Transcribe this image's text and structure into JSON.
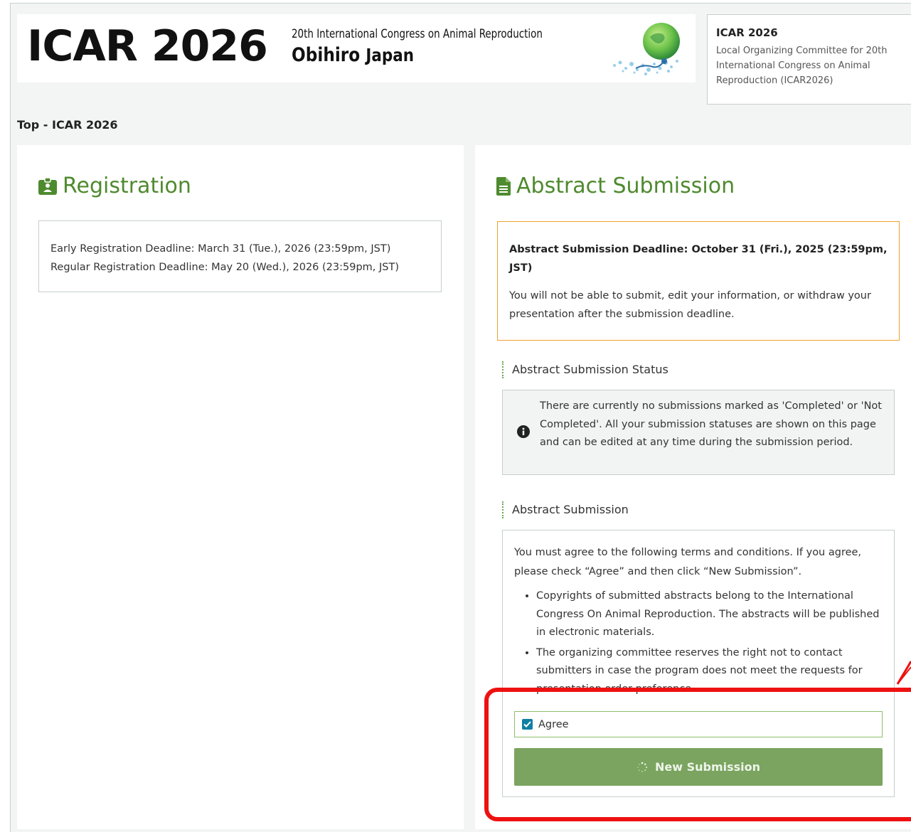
{
  "header": {
    "logo_main": "ICAR 2026",
    "logo_line1": "20th International Congress on Animal Reproduction",
    "logo_line2_city": "Obihiro",
    "logo_line2_country": "Japan"
  },
  "org": {
    "title": "ICAR 2026",
    "description": "Local Organizing Committee for 20th International Congress on Animal Reproduction (ICAR2026)"
  },
  "breadcrumb": "Top - ICAR 2026",
  "registration": {
    "title": "Registration",
    "early_deadline": "Early Registration Deadline: March 31 (Tue.), 2026 (23:59pm, JST)",
    "regular_deadline": "Regular Registration Deadline: May 20 (Wed.), 2026 (23:59pm, JST)"
  },
  "abstract": {
    "title": "Abstract Submission",
    "deadline_title": "Abstract Submission Deadline: October 31 (Fri.), 2025 (23:59pm, JST)",
    "deadline_note": "You will not be able to submit, edit your information, or withdraw your presentation after the submission deadline.",
    "status_label": "Abstract Submission Status",
    "status_message": "There are currently no submissions marked as 'Completed' or 'Not Completed'. All your submission statuses are shown on this page and can be edited at any time during the submission period.",
    "submission_label": "Abstract Submission",
    "terms_intro": "You must agree to the following terms and conditions. If you agree, please check “Agree” and then click “New Submission”.",
    "terms": [
      "Copyrights of submitted abstracts belong to the International Congress On Animal Reproduction. The abstracts will be published in electronic materials.",
      "The organizing committee reserves the right not to contact submitters in case the program does not meet the requests for presentation order preference."
    ],
    "agree_label": "Agree",
    "agree_checked": true,
    "new_submission_label": "New Submission"
  },
  "colors": {
    "accent_green": "#4e8a2e",
    "deadline_border": "#f0a030",
    "button_green": "#7aa45f",
    "highlight_red": "#ee1111",
    "checkbox_blue": "#0f7fa3"
  },
  "icons": {
    "registration": "id-badge-icon",
    "abstract": "file-text-icon",
    "status": "info-circle-icon",
    "checkbox": "check-icon",
    "button": "spinner-icon"
  }
}
